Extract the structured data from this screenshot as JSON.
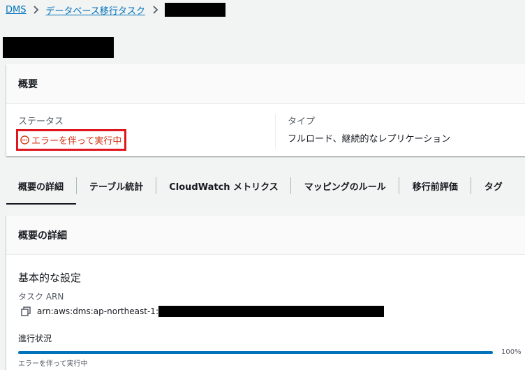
{
  "breadcrumb": {
    "dms": "DMS",
    "tasks": "データベース移行タスク"
  },
  "summary": {
    "header": "概要",
    "status_label": "ステータス",
    "status_value": "エラーを伴って実行中",
    "type_label": "タイプ",
    "type_value": "フルロード、継続的なレプリケーション"
  },
  "tabs": [
    {
      "label": "概要の詳細"
    },
    {
      "label": "テーブル統計"
    },
    {
      "label": "CloudWatch メトリクス"
    },
    {
      "label": "マッピングのルール"
    },
    {
      "label": "移行前評価"
    },
    {
      "label": "タグ"
    }
  ],
  "details": {
    "header": "概要の詳細",
    "section_title": "基本的な設定",
    "arn_label": "タスク ARN",
    "arn_prefix": "arn:aws:dms:ap-northeast-1:",
    "progress_label": "進行状況",
    "progress_value": 100,
    "progress_text": "100%",
    "progress_status": "エラーを伴って実行中"
  },
  "colors": {
    "link": "#0073bb",
    "error": "#d13212",
    "highlight_border": "#e0161e",
    "progress": "#0073bb"
  },
  "icons": {
    "status": "ellipsis-circle-icon",
    "copy": "copy-icon",
    "breadcrumb_separator": "chevron-right-icon"
  }
}
